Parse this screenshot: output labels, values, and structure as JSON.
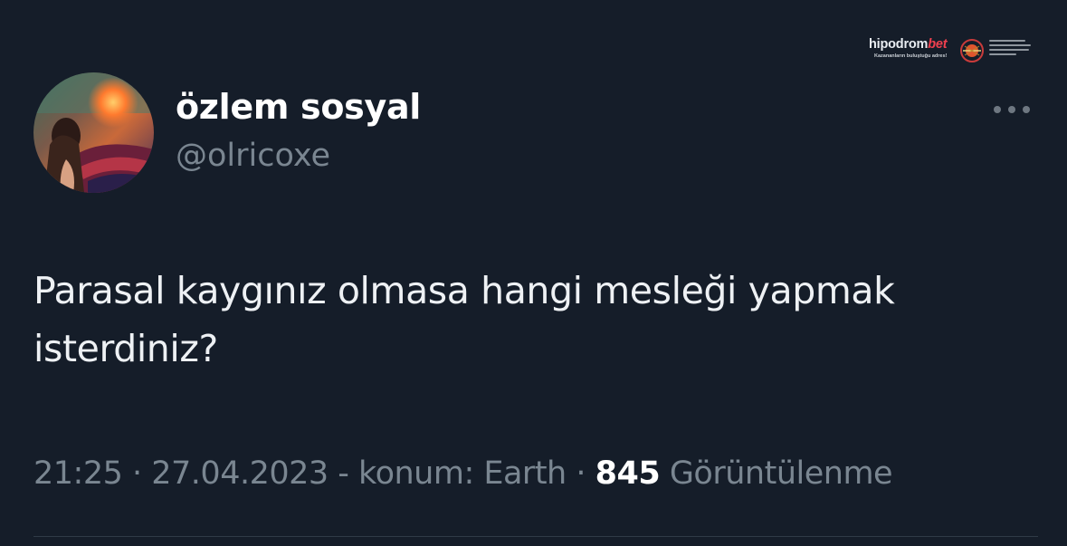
{
  "tweet": {
    "author": {
      "display_name": "özlem sosyal",
      "handle": "@olricoxe",
      "avatar": "profile-photo"
    },
    "text_lines": [
      "Parasal kaygınız olmasa hangi mesleği yapmak",
      "isterdiniz?"
    ],
    "meta": {
      "time": "21:25",
      "sep1": " · ",
      "date": "27.04.2023",
      "location": " - konum: Earth",
      "sep2": " · ",
      "views_count": "845",
      "views_label": " Görüntülenme"
    },
    "more_icon": "more-horizontal-icon"
  },
  "watermark": {
    "brand_main": "hipodrom",
    "brand_accent": "bet",
    "tagline": "Kazananların buluştuğu adres!"
  },
  "colors": {
    "background": "#151d29",
    "primary_text": "#ffffff",
    "secondary_text": "#7a8691",
    "divider": "#2f3b47",
    "brand_accent": "#f1404f"
  }
}
